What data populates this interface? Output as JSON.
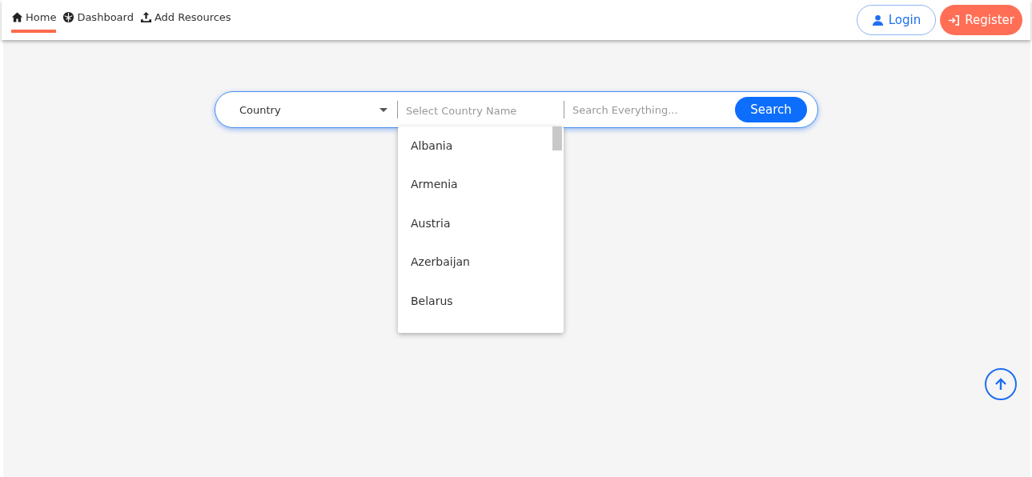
{
  "nav": {
    "items": [
      {
        "label": "Home",
        "selected": true
      },
      {
        "label": "Dashboard",
        "selected": false
      },
      {
        "label": "Add Resources",
        "selected": false
      }
    ],
    "login": "Login",
    "register": "Register"
  },
  "search": {
    "filter": "Country",
    "country_placeholder": "Select Country Name",
    "query_placeholder": "Search Everything...",
    "button": "Search",
    "options": [
      "Albania",
      "Armenia",
      "Austria",
      "Azerbaijan",
      "Belarus"
    ]
  }
}
